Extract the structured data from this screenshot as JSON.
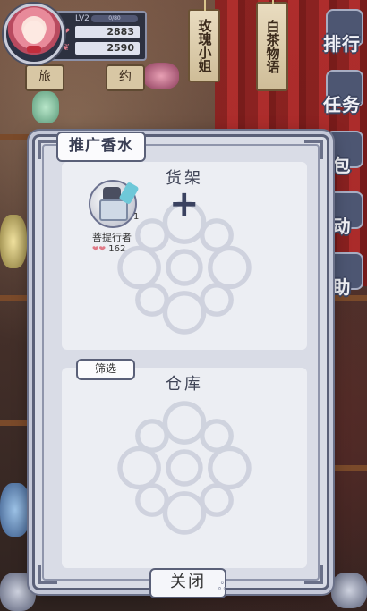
{
  "player": {
    "level_label": "LV2",
    "xp_text": "0/80",
    "currency_1": "2883",
    "currency_2": "2590"
  },
  "signs": [
    "玫瑰小姐",
    "白茶物语"
  ],
  "tags": [
    "旅",
    "约"
  ],
  "side_menu": [
    "排行",
    "任务",
    "包",
    "动",
    "助"
  ],
  "dialog": {
    "title": "推广香水",
    "shelf_title": "货架",
    "add_symbol": "+",
    "item": {
      "name": "菩提行者",
      "count": "1",
      "popularity": "162"
    },
    "storage_title": "仓库",
    "filter_label": "筛选",
    "close_label": "关闭"
  },
  "colors": {
    "dialog_bg": "#d9dce6",
    "frame": "#5a6078",
    "section_bg": "#eceef3",
    "accent_heart": "#e07a88"
  }
}
